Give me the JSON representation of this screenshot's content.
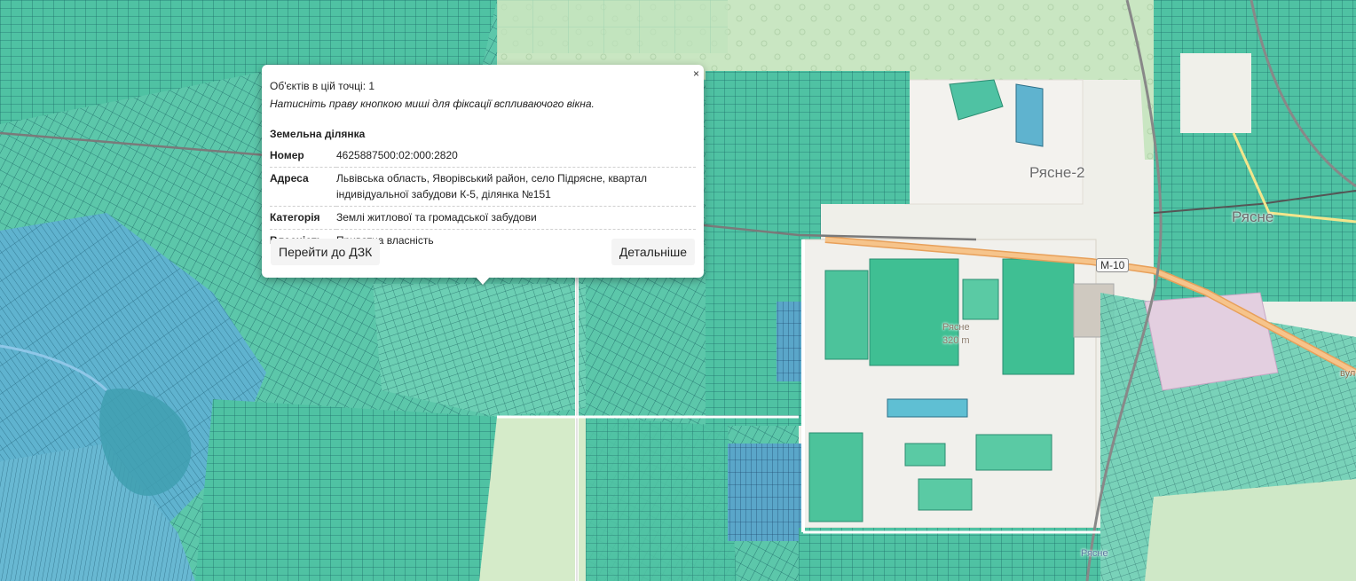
{
  "map": {
    "labels": {
      "ryasne2": "Рясне-2",
      "ryasne": "Рясне",
      "road_m10": "М-10",
      "peak_name": "Рясне",
      "peak_height": "320 m",
      "rail_station": "Рясне",
      "road_bulv": "вул."
    }
  },
  "popup": {
    "close": "×",
    "objects_count": "Об'єктів в цій точці: 1",
    "hint": "Натисніть праву кнопкою миші для фіксації вспливаючого вікна.",
    "heading": "Земельна ділянка",
    "rows": [
      {
        "key": "Номер",
        "value": "4625887500:02:000:2820"
      },
      {
        "key": "Адреса",
        "value": "Львівська область, Яворівський район, село Підрясне, квартал індивідуальної забудови К-5, ділянка №151"
      },
      {
        "key": "Категорія",
        "value": "Землі житлової та громадської забудови"
      },
      {
        "key": "Власність",
        "value": "Приватна власність"
      }
    ],
    "btn_dzk": "Перейти до ДЗК",
    "btn_details": "Детальніше"
  }
}
